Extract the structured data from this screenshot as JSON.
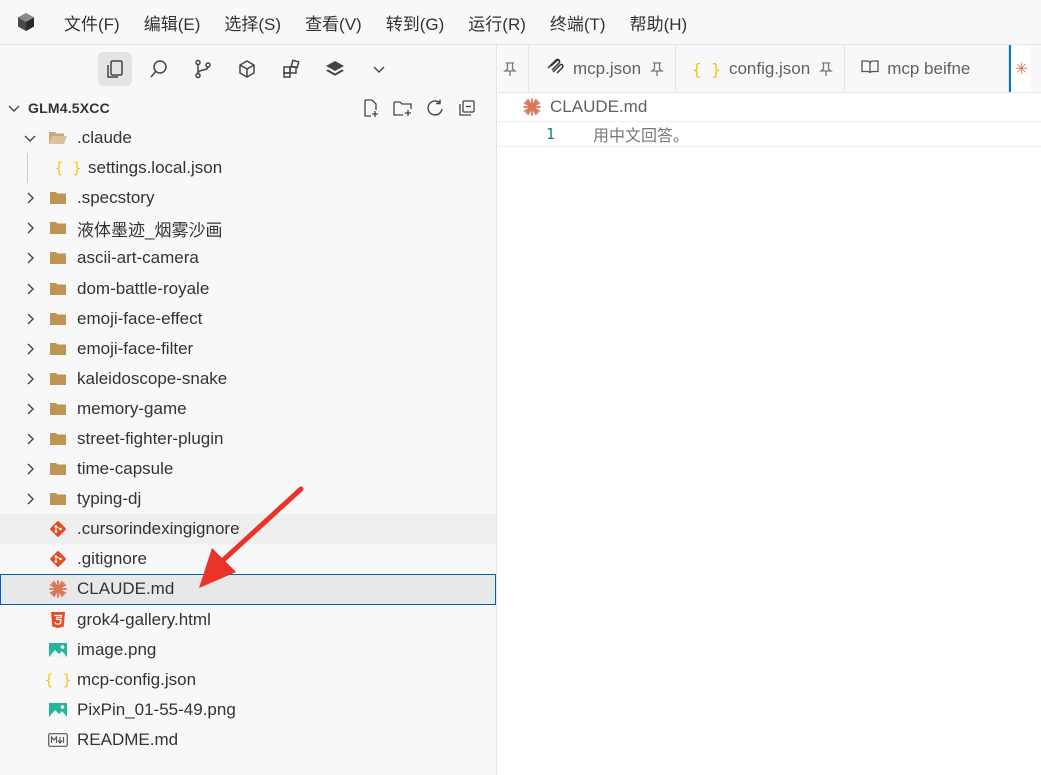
{
  "menu": [
    "文件(F)",
    "编辑(E)",
    "选择(S)",
    "查看(V)",
    "转到(G)",
    "运行(R)",
    "终端(T)",
    "帮助(H)"
  ],
  "explorer": {
    "title": "GLM4.5XCC",
    "items": [
      {
        "label": ".claude",
        "type": "folder-open",
        "depth": 1
      },
      {
        "label": "settings.local.json",
        "type": "json",
        "depth": 2
      },
      {
        "label": ".specstory",
        "type": "folder",
        "depth": 1
      },
      {
        "label": "液体墨迹_烟雾沙画",
        "type": "folder",
        "depth": 1
      },
      {
        "label": "ascii-art-camera",
        "type": "folder",
        "depth": 1
      },
      {
        "label": "dom-battle-royale",
        "type": "folder",
        "depth": 1
      },
      {
        "label": "emoji-face-effect",
        "type": "folder",
        "depth": 1
      },
      {
        "label": "emoji-face-filter",
        "type": "folder",
        "depth": 1
      },
      {
        "label": "kaleidoscope-snake",
        "type": "folder",
        "depth": 1
      },
      {
        "label": "memory-game",
        "type": "folder",
        "depth": 1
      },
      {
        "label": "street-fighter-plugin",
        "type": "folder",
        "depth": 1
      },
      {
        "label": "time-capsule",
        "type": "folder",
        "depth": 1
      },
      {
        "label": "typing-dj",
        "type": "folder",
        "depth": 1
      },
      {
        "label": ".cursorindexingignore",
        "type": "git",
        "depth": 0
      },
      {
        "label": ".gitignore",
        "type": "git",
        "depth": 0
      },
      {
        "label": "CLAUDE.md",
        "type": "claude",
        "depth": 0
      },
      {
        "label": "grok4-gallery.html",
        "type": "html",
        "depth": 0
      },
      {
        "label": "image.png",
        "type": "image",
        "depth": 0
      },
      {
        "label": "mcp-config.json",
        "type": "json",
        "depth": 0
      },
      {
        "label": "PixPin_01-55-49.png",
        "type": "image",
        "depth": 0
      },
      {
        "label": "README.md",
        "type": "markdown",
        "depth": 0
      }
    ]
  },
  "tabs": [
    {
      "label": "mcp.json"
    },
    {
      "label": "config.json"
    },
    {
      "label": "mcp beifne"
    }
  ],
  "editor": {
    "breadcrumb": "CLAUDE.md",
    "line_number": "1",
    "line_text": "用中文回答。"
  },
  "colors": {
    "folder": "#c09553",
    "json": "#f5c518",
    "git": "#e44d26",
    "claude": "#d97757",
    "html": "#e44d26",
    "image": "#26b59a",
    "accent": "#0078d4",
    "arrow": "#e8322a"
  }
}
